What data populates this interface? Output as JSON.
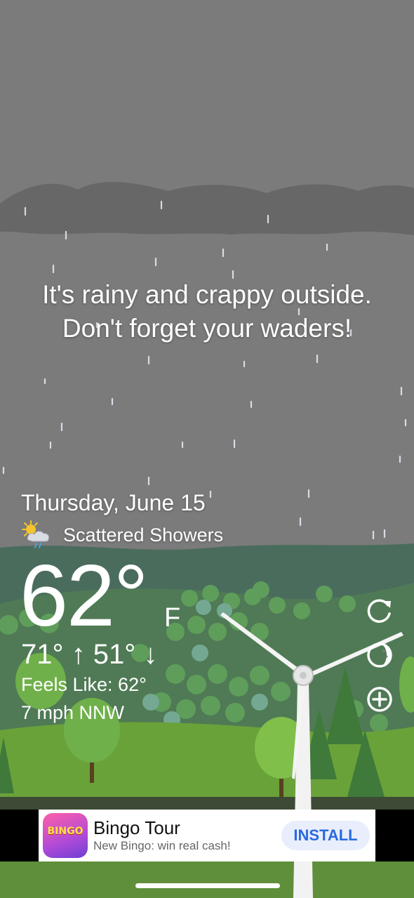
{
  "weather": {
    "headline_line1": "It's rainy and crappy outside.",
    "headline_line2": "Don't forget your waders!",
    "date": "Thursday, June 15",
    "condition": "Scattered Showers",
    "condition_icon": "sun-cloud-rain-icon",
    "temperature": "62°",
    "unit": "F",
    "high_low": "71° ↑ 51° ↓",
    "feels_like": "Feels Like: 62°",
    "wind": "7 mph NNW"
  },
  "actions": {
    "refresh_icon": "refresh-icon",
    "moon_icon": "moon-icon",
    "add_icon": "add-circle-icon"
  },
  "ad": {
    "icon_text": "BINGO",
    "title": "Bingo Tour",
    "subtitle": "New Bingo: win real cash!",
    "install_label": "INSTALL"
  },
  "colors": {
    "sky": "#7a7a7a",
    "cloud": "#666666",
    "hills_back": "#4a6c5d",
    "grass": "#6aa23a",
    "accent": "#2a6ae0"
  }
}
